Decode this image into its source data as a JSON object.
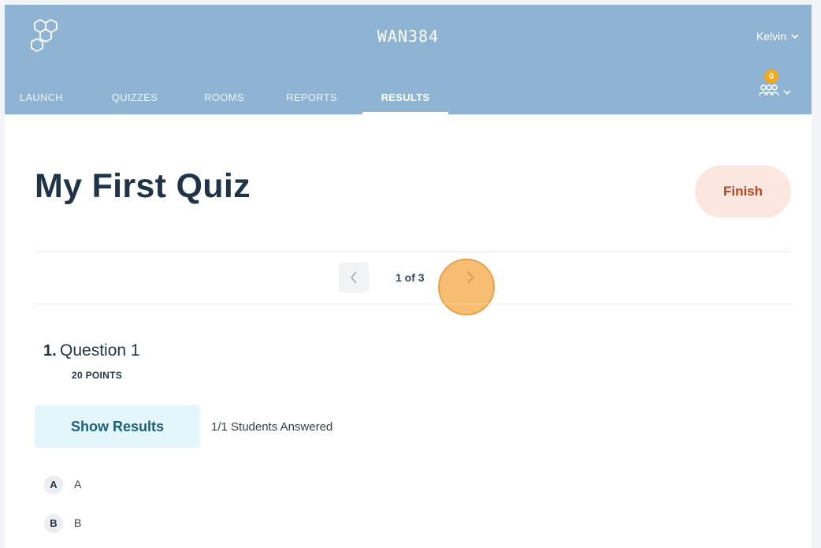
{
  "header": {
    "room_code": "WAN384",
    "user_name": "Kelvin",
    "notification_count": "0",
    "bg_color": "#8eb3d3",
    "tabs": [
      {
        "label": "LAUNCH",
        "active": false
      },
      {
        "label": "QUIZZES",
        "active": false
      },
      {
        "label": "ROOMS",
        "active": false
      },
      {
        "label": "REPORTS",
        "active": false
      },
      {
        "label": "RESULTS",
        "active": true
      }
    ]
  },
  "main": {
    "title": "My First Quiz",
    "finish_label": "Finish",
    "pager": {
      "count": "1 of 3"
    },
    "question": {
      "number": "1.",
      "text": "Question 1",
      "points": "20 POINTS",
      "show_results_label": "Show Results",
      "answered": "1/1 Students Answered",
      "answers": [
        {
          "letter": "A",
          "text": "A"
        },
        {
          "letter": "B",
          "text": "B"
        }
      ]
    }
  },
  "colors": {
    "title": "#1f3446",
    "finish_text": "#b8441f",
    "finish_bg": "#fbe6e0",
    "badge": "#f2a81d",
    "highlight": "#f4b25a"
  }
}
